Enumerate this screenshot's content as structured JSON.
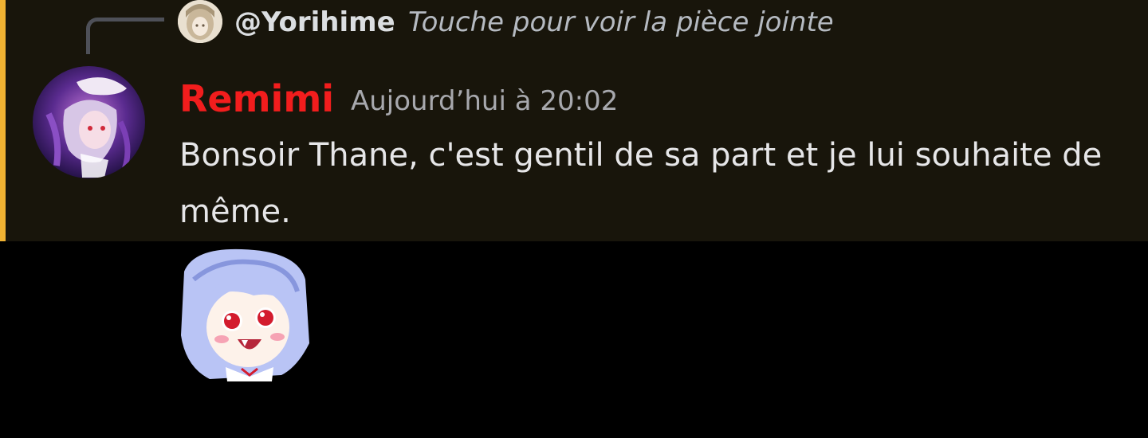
{
  "reply": {
    "author": "@Yorihime",
    "preview": "Touche pour voir la pièce jointe",
    "avatar_icon": "user-avatar-icon"
  },
  "message": {
    "author": "Remimi",
    "timestamp": "Aujourd’hui à 20:02",
    "text": "Bonsoir Thane, c'est gentil de sa part et je lui souhaite de même.",
    "author_color": "#f21d1d",
    "avatar_icon": "user-avatar-icon",
    "sticker_icon": "sticker-icon"
  },
  "colors": {
    "background": "#000000",
    "highlight": "#18150b",
    "mention_bar": "#f0b232"
  }
}
